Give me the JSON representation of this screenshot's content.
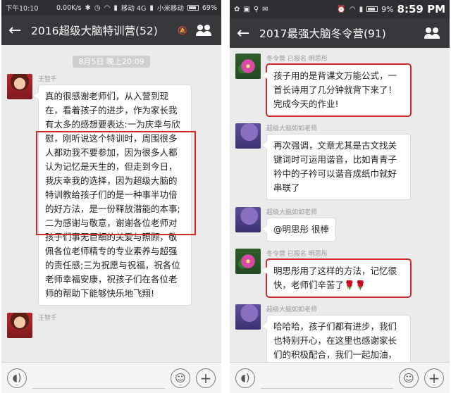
{
  "left": {
    "status": {
      "time": "下午10:10",
      "speed": "0.00K/s",
      "carrier1": "移动 4G",
      "carrier2": "小米移动",
      "battery": "69%"
    },
    "title": "2016超级大脑特训营(52)",
    "timestamp": "8月5日 晚上20:09",
    "messages": [
      {
        "sender": "王智千",
        "text": "真的很感谢老师们，从入营到现在，看着孩子的进步，作为家长我有太多的感想要表达:一为庆幸与欣慰，刚听说这个特训时，周围很多人都劝我不要参加，因为很多人都认为记忆是天生的，但走到今日，我庆幸我的选择，因为超级大脑的特训教给孩子们的是一种事半功倍的好方法，是一份释放潜能的本事;二为感谢与敬意，谢谢各位老师对孩子们事无巨细的关爱与照顾，敬佩各位老师精专的专业素养与超强的责任感;三为祝愿与祝福，祝各位老师幸福安康，祝孩子们在各位老师的帮助下能够快乐地飞翔!"
      },
      {
        "sender": "王智千",
        "text": ""
      }
    ]
  },
  "right": {
    "status": {
      "time": "8:59 PM",
      "battery": "9%"
    },
    "title": "2017最强大脑冬令营(91)",
    "messages": [
      {
        "sender": "冬令营 已报名 明思彤",
        "text": "孩子用的是背课文万能公式，一首长诗用了几分钟就背下来了！完成今天的作业!",
        "highlight": true
      },
      {
        "sender": "超级大脑如如老师",
        "text": "再次强调，文章尤其是古文找关键词时可运用谐音，比如青青子衿中的子衿可以谐音成纸巾就好串联了",
        "highlight": false
      },
      {
        "sender": "超级大脑如如老师",
        "text": "@明思彤  很棒",
        "highlight": false
      },
      {
        "sender": "冬令营 已报名 明思彤",
        "text": "明思彤用了这样的方法，记忆很快，老师们辛苦了🌹🌹",
        "highlight": true
      },
      {
        "sender": "超级大脑如如老师",
        "text": "哈哈哈，孩子们都有进步，我们也特别开心，在这里也感谢家长们的积极配合，我们一起加油，帮助孩子快快成",
        "highlight": false
      }
    ]
  },
  "colors": {
    "header": "#36383c",
    "statusbar": "#2d2f33",
    "highlight": "#d02a2a",
    "chat_bg": "#ebebeb"
  },
  "icons": {
    "back": "back-arrow-icon",
    "group": "group-members-icon",
    "mute": "mute-icon",
    "voice": "voice-icon",
    "emoji": "emoji-icon",
    "plus": "plus-icon"
  }
}
